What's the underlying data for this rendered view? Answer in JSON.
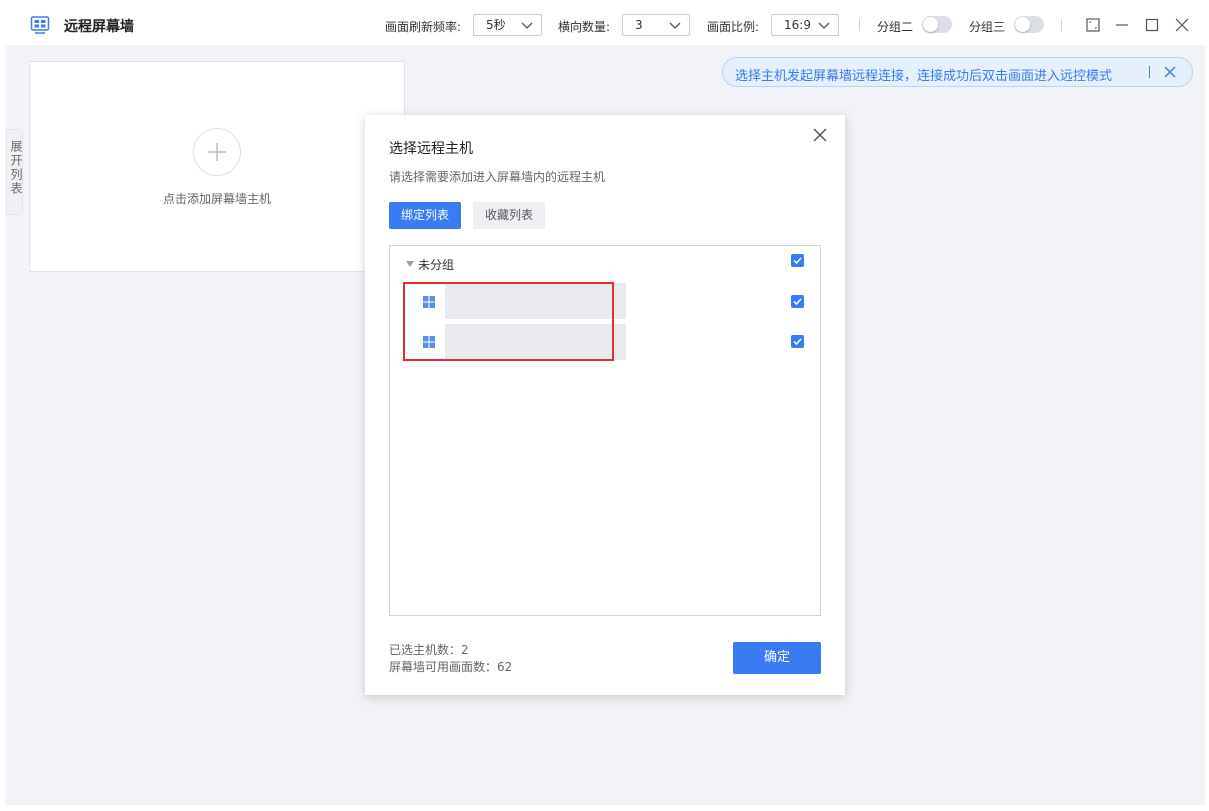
{
  "app": {
    "title": "远程屏幕墙"
  },
  "toolbar": {
    "refresh_label": "画面刷新频率:",
    "refresh_value": "5秒",
    "columns_label": "横向数量:",
    "columns_value": "3",
    "ratio_label": "画面比例:",
    "ratio_value": "16:9",
    "group2_label": "分组二",
    "group3_label": "分组三"
  },
  "sidebar_tab": {
    "label": "展开列表"
  },
  "add_card": {
    "text": "点击添加屏幕墙主机"
  },
  "notice": {
    "text": "选择主机发起屏幕墙远程连接，连接成功后双击画面进入远控模式"
  },
  "dialog": {
    "title": "选择远程主机",
    "subtitle": "请选择需要添加进入屏幕墙内的远程主机",
    "tabs": [
      {
        "label": "绑定列表",
        "active": true
      },
      {
        "label": "收藏列表",
        "active": false
      }
    ],
    "group": {
      "label": "未分组",
      "checked": true
    },
    "hosts": [
      {
        "name": "",
        "checked": true
      },
      {
        "name": "",
        "checked": true
      }
    ],
    "selected_count_label": "已选主机数：2",
    "available_label": "屏幕墙可用画面数：62",
    "confirm_label": "确定"
  },
  "colors": {
    "accent": "#3a7af2",
    "highlight": "#e0302f"
  },
  "icons": {
    "app": "screen-wall-icon",
    "host": "windows-icon",
    "plus": "plus-icon",
    "close": "close-icon"
  }
}
